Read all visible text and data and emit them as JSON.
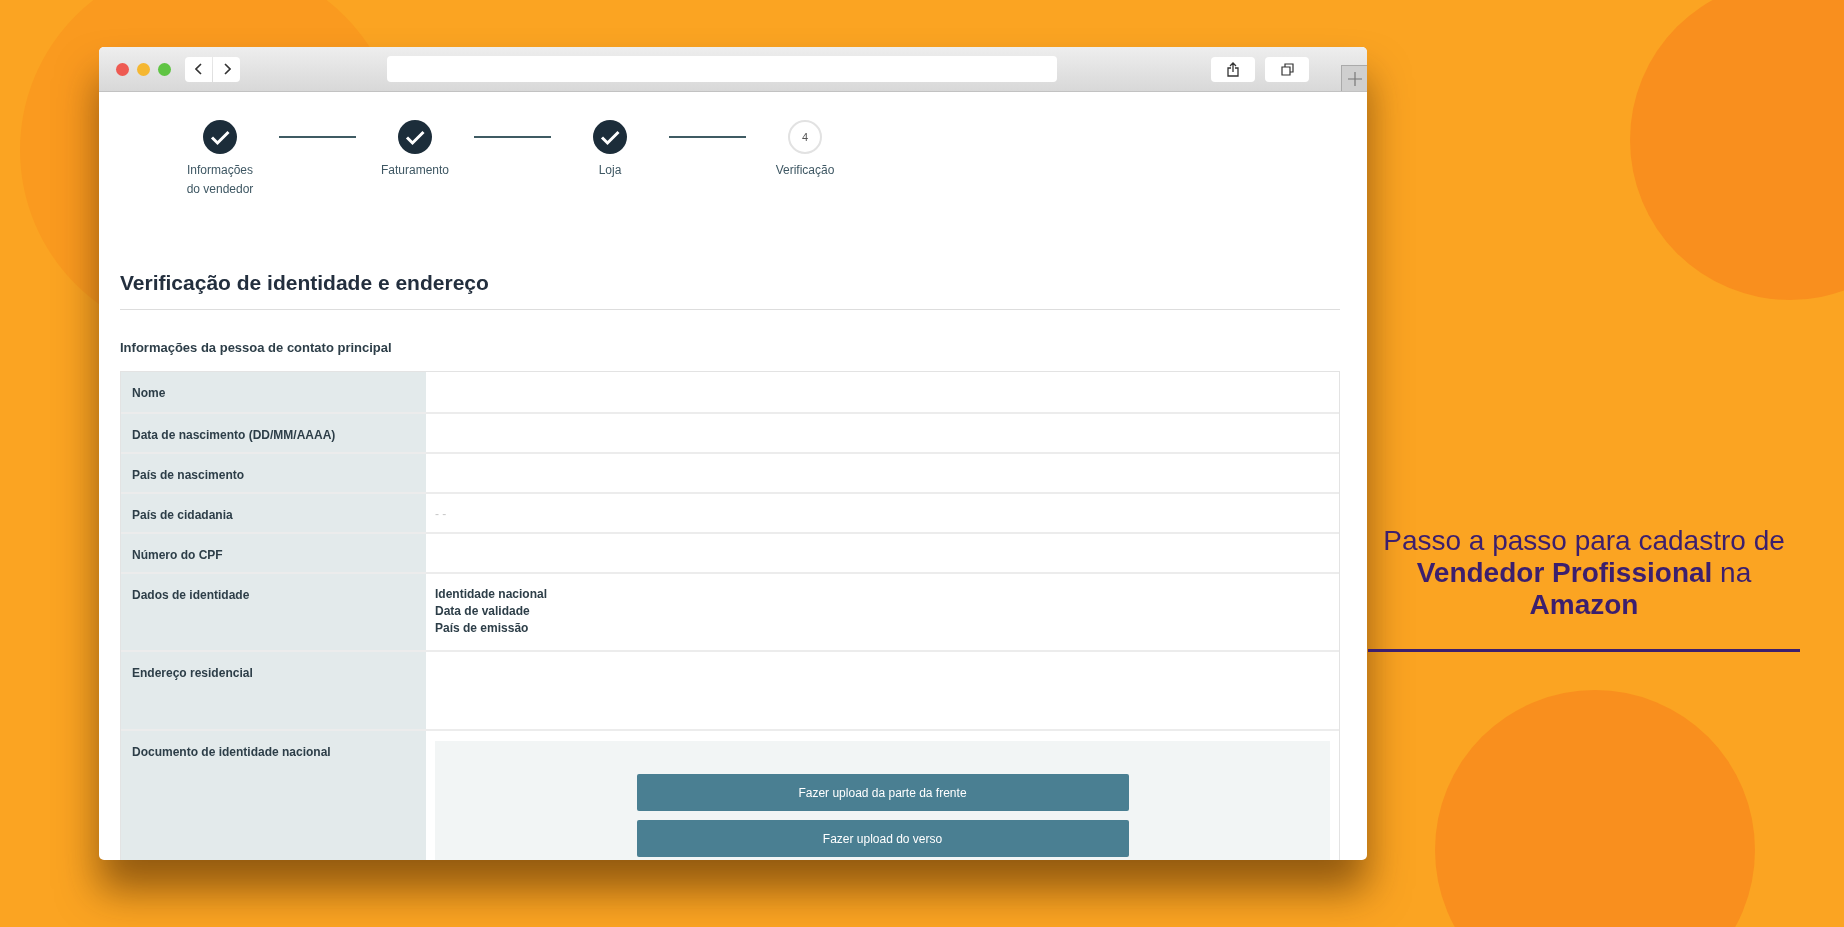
{
  "steps": [
    {
      "label": "Informações do vendedor",
      "completed": true
    },
    {
      "label": "Faturamento",
      "completed": true
    },
    {
      "label": "Loja",
      "completed": true
    },
    {
      "label": "Verificação",
      "completed": false,
      "number": "4"
    }
  ],
  "section_title": "Verificação de identidade e endereço",
  "subsection_title": "Informações da pessoa de contato principal",
  "fields": [
    {
      "kind": "text",
      "label": "Nome"
    },
    {
      "kind": "text",
      "label": "Data de nascimento (DD/MM/AAAA)"
    },
    {
      "kind": "text",
      "label": "País de nascimento"
    },
    {
      "kind": "text",
      "label": "País de cidadania",
      "value": "- -"
    },
    {
      "kind": "text",
      "label": "Número do CPF"
    },
    {
      "kind": "lines",
      "label": "Dados de identidade",
      "lines": [
        "Identidade nacional",
        "Data de validade",
        "País de emissão"
      ]
    },
    {
      "kind": "block",
      "label": "Endereço residencial"
    },
    {
      "kind": "upload",
      "label": "Documento de identidade nacional",
      "buttons": [
        "Fazer upload da parte da frente",
        "Fazer upload do verso"
      ]
    }
  ],
  "promo": {
    "text": "Passo a passo para cadastro de **Vendedor Profissional** na **Amazon**"
  }
}
